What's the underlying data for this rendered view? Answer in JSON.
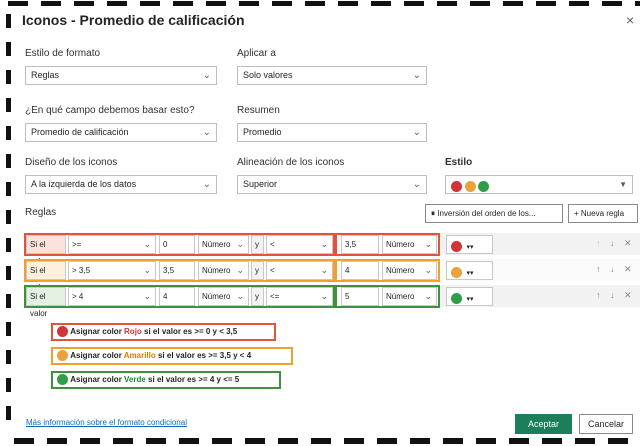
{
  "dialog": {
    "title": "Iconos - Promedio de calificación",
    "close": "×"
  },
  "format_style": {
    "label": "Estilo de formato",
    "value": "Reglas"
  },
  "apply_to": {
    "label": "Aplicar a",
    "value": "Solo valores"
  },
  "based_field": {
    "label": "¿En qué campo debemos basar esto?",
    "value": "Promedio de calificación"
  },
  "summary": {
    "label": "Resumen",
    "value": "Promedio"
  },
  "icon_layout": {
    "label": "Diseño de los iconos",
    "value": "A la izquierda de los datos"
  },
  "icon_alignment": {
    "label": "Alineación de los iconos",
    "value": "Superior"
  },
  "style": {
    "label": "Estilo",
    "colors": [
      "#d13438",
      "#e8a33d",
      "#2e9e48"
    ]
  },
  "rules_label": "Reglas",
  "reverse_button": "Inversión del orden de los...",
  "new_rule_button": "+ Nueva regla",
  "rules": [
    {
      "if": "Si el valor",
      "op1": ">=",
      "v1": "0",
      "t1": "Número",
      "and": "y",
      "op2": "<",
      "v2": "3,5",
      "t2": "Número",
      "color": "#d13438",
      "border": "#e0553a"
    },
    {
      "if": "Si el valor",
      "op1": "> 3,5",
      "v1": "3,5",
      "t1": "Número",
      "and": "y",
      "op2": "<",
      "v2": "4",
      "t2": "Número",
      "color": "#e8a33d",
      "border": "#f0a030"
    },
    {
      "if": "Si el valor",
      "op1": "> 4",
      "v1": "4",
      "t1": "Número",
      "and": "y",
      "op2": "<=",
      "v2": "5",
      "t2": "Número",
      "color": "#2e9e48",
      "border": "#3f8f3f"
    }
  ],
  "legend": [
    {
      "pre": "Asignar color ",
      "color_name": "Rojo",
      "post": " si el valor es >= 0 y < 3,5",
      "color": "#d13438",
      "text_color": "#d13438"
    },
    {
      "pre": "Asignar color ",
      "color_name": "Amarillo",
      "post": " si el valor es >= 3,5 y < 4",
      "color": "#e8a33d",
      "text_color": "#e07b00"
    },
    {
      "pre": "Asignar color ",
      "color_name": "Verde",
      "post": " si el valor es >= 4 y <= 5",
      "color": "#2e9e48",
      "text_color": "#1e8a3a"
    }
  ],
  "more_info_link": "Más información sobre el formato condicional",
  "accept_button": "Aceptar",
  "cancel_button": "Cancelar"
}
